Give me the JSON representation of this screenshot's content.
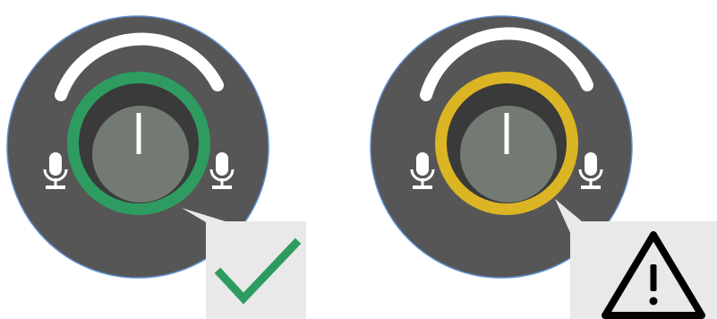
{
  "colors": {
    "body": "#565656",
    "body_outline": "#5b8fd0",
    "arc": "#ffffff",
    "knob_recess": "#3a3a3a",
    "knob_cap": "#737a73",
    "pointer": "#ffffff",
    "mic": "#ffffff",
    "badge_bg": "#e9e9e9"
  },
  "knobs": [
    {
      "state": "ok",
      "ring_color": "#2e9c61",
      "status_icon": "checkmark-icon",
      "status_color": "#2e9c61"
    },
    {
      "state": "warning",
      "ring_color": "#dcb524",
      "status_icon": "warning-icon",
      "status_color": "#000000"
    }
  ]
}
